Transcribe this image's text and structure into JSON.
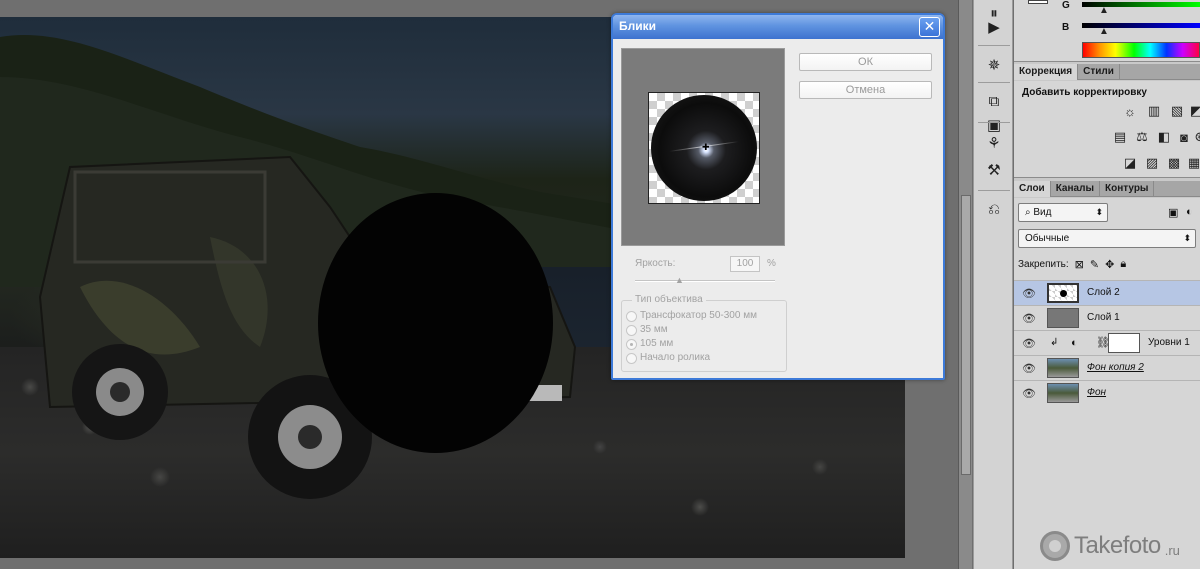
{
  "dialog": {
    "title": "Блики",
    "ok_label": "ОК",
    "cancel_label": "Отмена",
    "brightness": {
      "label": "Яркость:",
      "value": "100",
      "unit": "%"
    },
    "lens_type": {
      "legend": "Тип объектива",
      "options": [
        "Трансфокатор 50-300 мм",
        "35 мм",
        "105 мм",
        "Начало ролика"
      ],
      "selected": "105 мм"
    }
  },
  "color_panel": {
    "channels": [
      "G",
      "B"
    ]
  },
  "adjustments_panel": {
    "tabs": [
      "Коррекция",
      "Стили"
    ],
    "title": "Добавить корректировку",
    "icons": [
      "brightness-icon",
      "levels-icon",
      "curves-icon",
      "exposure-icon",
      "vibrance-icon",
      "balance-icon",
      "bw-icon",
      "photo-filter-icon",
      "channel-mixer-icon",
      "invert-icon",
      "posterize-icon",
      "threshold-icon",
      "gradient-map-icon",
      "selective-color-icon"
    ]
  },
  "layers_panel": {
    "tabs": [
      "Слои",
      "Каналы",
      "Контуры"
    ],
    "filter_label": "Вид",
    "blend_mode": "Обычные",
    "lock_label": "Закрепить:",
    "layers": [
      {
        "name": "Слой 2",
        "selected": true
      },
      {
        "name": "Слой 1"
      },
      {
        "name": "Уровни 1"
      },
      {
        "name": "Фон копия 2"
      },
      {
        "name": "Фон"
      }
    ]
  },
  "watermark": {
    "name": "Takefoto",
    "suffix": ".ru"
  },
  "colors": {
    "dialog_title_blue": "#3d72cf",
    "selected_layer": "#b6c6e4"
  }
}
